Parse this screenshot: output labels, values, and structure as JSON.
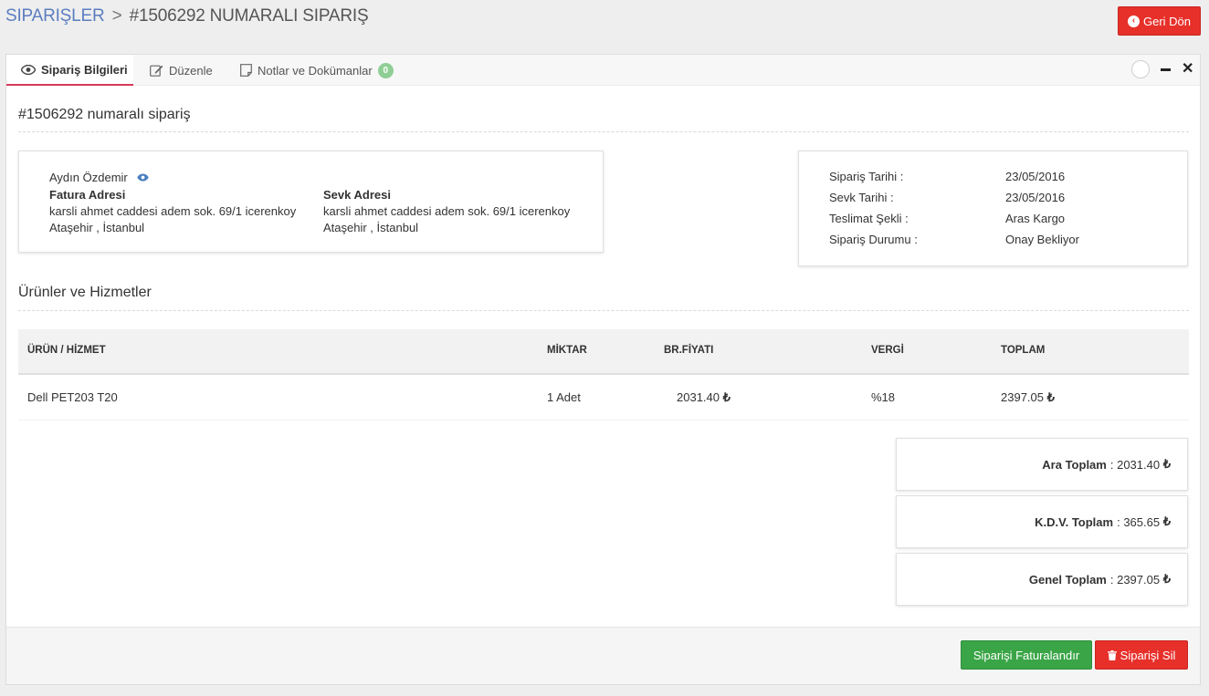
{
  "breadcrumb": {
    "root": "SIPARIŞLER",
    "separator": ">",
    "current": "#1506292 NUMARALI SIPARIŞ"
  },
  "header": {
    "back_label": "Geri Dön",
    "back_icon": "chevron-left-circle-icon"
  },
  "tabs": [
    {
      "label": "Sipariş Bilgileri",
      "icon": "eye-icon",
      "active": true
    },
    {
      "label": "Düzenle",
      "icon": "edit-icon",
      "active": false
    },
    {
      "label": "Notlar ve Dokümanlar",
      "icon": "note-icon",
      "active": false,
      "badge": "0"
    }
  ],
  "order": {
    "title": "#1506292 numaralı sipariş",
    "customer": {
      "name": "Aydın Özdemir",
      "billing": {
        "title": "Fatura Adresi",
        "line1": "karsli ahmet caddesi adem sok. 69/1 icerenkoy",
        "line2": "Ataşehir , İstanbul"
      },
      "shipping": {
        "title": "Sevk Adresi",
        "line1": "karsli ahmet caddesi adem sok. 69/1 icerenkoy",
        "line2": "Ataşehir , İstanbul"
      }
    },
    "info": [
      {
        "label": "Sipariş Tarihi :",
        "value": "23/05/2016"
      },
      {
        "label": "Sevk Tarihi :",
        "value": "23/05/2016"
      },
      {
        "label": "Teslimat Şekli :",
        "value": "Aras Kargo"
      },
      {
        "label": "Sipariş Durumu :",
        "value": "Onay Bekliyor"
      }
    ]
  },
  "products": {
    "title": "Ürünler ve Hizmetler",
    "currency_symbol": "₺",
    "columns": [
      "ÜRÜN / HİZMET",
      "MİKTAR",
      "BR.FİYATI",
      "VERGİ",
      "TOPLAM"
    ],
    "rows": [
      {
        "name": "Dell PET203 T20",
        "qty": "1 Adet",
        "price": "2031.40",
        "tax": "%18",
        "total": "2397.05"
      }
    ]
  },
  "totals": [
    {
      "label": "Ara Toplam",
      "value": "2031.40"
    },
    {
      "label": "K.D.V. Toplam",
      "value": "365.65"
    },
    {
      "label": "Genel Toplam",
      "value": "2397.05"
    }
  ],
  "footer": {
    "invoice_label": "Siparişi Faturalandır",
    "delete_label": "Siparişi Sil",
    "delete_icon": "trash-icon"
  },
  "colors": {
    "accent_link": "#5b7dc0",
    "danger": "#e7302a",
    "success": "#3aa547",
    "active_tab_underline": "#d63a5a",
    "badge": "#8fcf95"
  }
}
